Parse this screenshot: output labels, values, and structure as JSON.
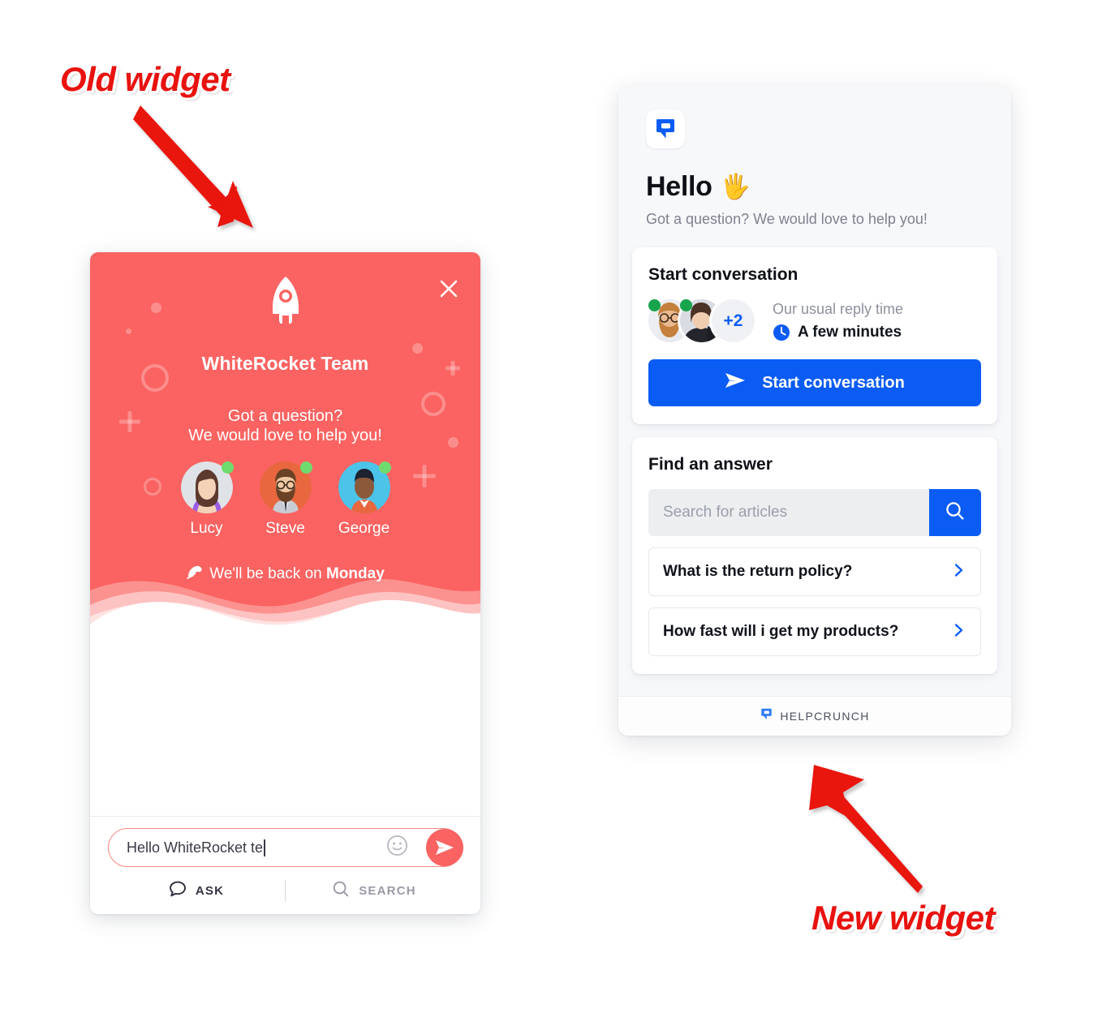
{
  "annotations": {
    "old_label": "Old widget",
    "new_label": "New widget",
    "arrow_color": "#e8120f"
  },
  "old_widget": {
    "brand_color": "#fa6361",
    "close_icon": "close-icon",
    "logo_icon": "rocket-icon",
    "team_name": "WhiteRocket Team",
    "greeting_line1": "Got a question?",
    "greeting_line2": "We would love to help you!",
    "agents": [
      {
        "name": "Lucy",
        "status": "online"
      },
      {
        "name": "Steve",
        "status": "online"
      },
      {
        "name": "George",
        "status": "online"
      }
    ],
    "away_icon": "sleep-icon",
    "away_prefix": "We'll be back on ",
    "away_day": "Monday",
    "composer": {
      "value": "Hello WhiteRocket te",
      "emoji_icon": "emoji-smiley-icon",
      "send_icon": "send-paper-plane-icon"
    },
    "tabs": [
      {
        "label": "ASK",
        "icon": "chat-bubble-icon",
        "active": true
      },
      {
        "label": "SEARCH",
        "icon": "magnifier-icon",
        "active": false
      }
    ]
  },
  "new_widget": {
    "accent_color": "#0b5cf5",
    "logo_icon": "helpcrunch-logo-icon",
    "title": "Hello",
    "title_emoji": "🖐",
    "greeting": "Got a question? We would love to help you!",
    "start_card": {
      "title": "Start conversation",
      "extra_agents": "+2",
      "reply_label": "Our usual reply time",
      "reply_value": "A few minutes",
      "clock_icon": "clock-icon",
      "button_label": "Start conversation",
      "button_icon": "send-paper-plane-icon"
    },
    "find_card": {
      "title": "Find an answer",
      "search_placeholder": "Search for articles",
      "search_value": "",
      "search_icon": "magnifier-icon",
      "articles": [
        {
          "question": "What is the return policy?",
          "chevron": "chevron-right-icon"
        },
        {
          "question": "How fast will i get my products?",
          "chevron": "chevron-right-icon"
        }
      ]
    },
    "footer": {
      "brand": "HELPCRUNCH",
      "icon": "helpcrunch-logo-icon"
    }
  }
}
